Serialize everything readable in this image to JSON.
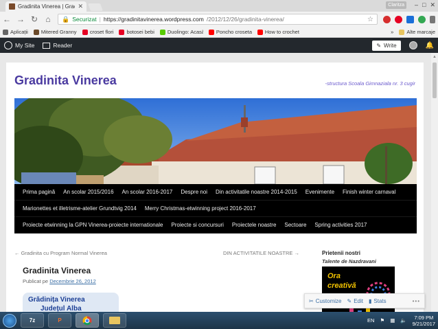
{
  "browser": {
    "tab_title": "Gradinita Vinerea | Grad",
    "profile_label": "Claritza",
    "secure_label": "Securizat",
    "url_host": "https://gradinitavinerea.wordpress.com",
    "url_path": "/2012/12/26/gradinita-vinerea/"
  },
  "bookmarks": [
    {
      "label": "Aplicații",
      "color": "#666"
    },
    {
      "label": "Mitered Granny Squa",
      "color": "#6b4a2a"
    },
    {
      "label": "croset flori",
      "color": "#e60023"
    },
    {
      "label": "botosei bebi",
      "color": "#e60023"
    },
    {
      "label": "Duolingo: Acasă",
      "color": "#58cc02"
    },
    {
      "label": "Poncho crosetat - Yo",
      "color": "#ff0000"
    },
    {
      "label": "How to crochet a qui",
      "color": "#ff0000"
    }
  ],
  "bookmarks_more": "»",
  "bookmarks_other": "Alte marcaje",
  "wpbar": {
    "my_site": "My Site",
    "reader": "Reader",
    "write": "Write"
  },
  "site": {
    "title": "Gradinita Vinerea",
    "description": "-structura Scoala Gimnaziala nr. 3 cugir"
  },
  "nav": {
    "row1": [
      "Prima pagină",
      "An scolar 2015/2016",
      "An scolar 2016-2017",
      "Despre noi",
      "Din activitatile noastre 2014-2015",
      "Evenimente",
      "Finish winter carnaval"
    ],
    "row2": [
      "Marionettes et illetrisme-atelier Grundtvig 2014",
      "Merry Christmas-etwinning project 2016-2017"
    ],
    "row3": [
      "Proiecte etwinning la GPN Vinerea-proiecte internationale",
      "Proiecte si concursuri",
      "Proiectele noastre",
      "Sectoare",
      "Spring activities 2017"
    ]
  },
  "post": {
    "prev": "← Gradinita cu Program Normal Vinerea",
    "next": "DIN ACTIVITATILE NOASTRE →",
    "title": "Gradinita Vinerea",
    "published_prefix": "Publicat pe",
    "published_date": "Decembrie 26, 2012",
    "image_text_1": "Grădinița Vinerea",
    "image_text_2": "Județul Alba"
  },
  "sidebar": {
    "title": "Prietenii nostri",
    "subtitle": "Talente de Nazdravani",
    "widget_text_1": "Ora",
    "widget_text_2": "creativă"
  },
  "actionbar": {
    "customize": "Customize",
    "edit": "Edit",
    "stats": "Stats",
    "more": "•••"
  },
  "taskbar": {
    "app_7z": "7z",
    "app_ppt": "P",
    "lang": "EN",
    "time": "7:09 PM",
    "date": "9/21/2017"
  }
}
